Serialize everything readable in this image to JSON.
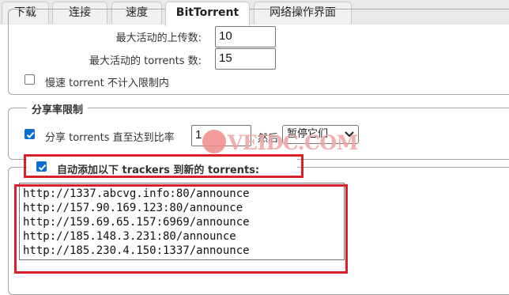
{
  "tabs": [
    {
      "label": "下载"
    },
    {
      "label": "连接"
    },
    {
      "label": "速度"
    },
    {
      "label": "BitTorrent",
      "active": true
    },
    {
      "label": "网络操作界面"
    }
  ],
  "queue": {
    "max_upload_label": "最大活动的上传数:",
    "max_upload_value": "10",
    "max_torrents_label": "最大活动的 torrents 数:",
    "max_torrents_value": "15",
    "slow_torrent_label": "慢速 torrent 不计入限制内",
    "slow_torrent_checked": false
  },
  "share_ratio": {
    "legend": "分享率限制",
    "seed_label": "分享 torrents 直至达到比率",
    "seed_checked": true,
    "ratio_value": "1",
    "then_label": "然后",
    "action_selected": "暂停它们"
  },
  "trackers": {
    "label": "自动添加以下 trackers 到新的 torrents:",
    "checked": true,
    "list": "http://1337.abcvg.info:80/announce\nhttp://157.90.169.123:80/announce\nhttp://159.69.65.157:6969/announce\nhttp://185.148.3.231:80/announce\nhttp://185.230.4.150:1337/announce"
  },
  "watermark": {
    "text": "VEIDC.COM"
  },
  "colors": {
    "accent": "#0b6fd0",
    "highlight": "#d9202a"
  }
}
